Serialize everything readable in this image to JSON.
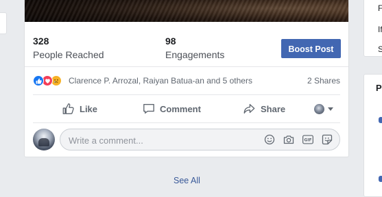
{
  "post": {
    "stats": {
      "reached_value": "328",
      "reached_label": "People Reached",
      "engagements_value": "98",
      "engagements_label": "Engagements",
      "boost_label": "Boost Post"
    },
    "reactions": {
      "icons": [
        "like-icon",
        "love-icon",
        "sad-icon"
      ],
      "names": "Clarence P. Arrozal, Raiyan Batua-an and 5 others",
      "shares": "2 Shares"
    },
    "actions": {
      "like_label": "Like",
      "comment_label": "Comment",
      "share_label": "Share"
    },
    "comment": {
      "placeholder": "Write a comment..."
    },
    "see_all_label": "See All"
  },
  "right_panel": {
    "top_lines": [
      "F",
      "If",
      "S"
    ],
    "bottom_header": "P"
  },
  "colors": {
    "brand_blue": "#4267b2",
    "like_blue": "#1877f2",
    "love_red": "#f33e58",
    "sad_yellow": "#f7b125",
    "link": "#385898"
  }
}
